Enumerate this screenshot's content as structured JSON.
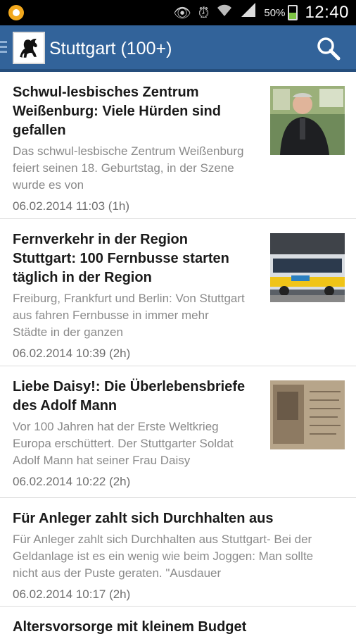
{
  "status_bar": {
    "app_icon": "notification-app-icon",
    "icons": [
      "eye-icon",
      "alarm-icon",
      "wifi-icon",
      "signal-icon"
    ],
    "battery_percent": "50%",
    "time": "12:40"
  },
  "action_bar": {
    "title": "Stuttgart (100+)",
    "logo_icon": "stuttgart-horse-logo",
    "search_icon": "search-icon"
  },
  "articles": [
    {
      "headline": "Schwul-lesbisches Zentrum Weißenburg: Viele Hürden sind gefallen",
      "teaser": "Das schwul-lesbische Zentrum Weißenburg feiert seinen 18. Geburtstag, in der Szene wurde es von",
      "meta": "06.02.2014 11:03 (1h)",
      "has_thumbnail": true
    },
    {
      "headline": "Fernverkehr in der Region Stuttgart: 100 Fernbusse starten täglich in der Region",
      "teaser": "Freiburg, Frankfurt und Berlin: Von Stuttgart aus fahren Fernbusse in immer mehr Städte in der ganzen",
      "meta": "06.02.2014 10:39 (2h)",
      "has_thumbnail": true
    },
    {
      "headline": "Liebe Daisy!: Die Überlebensbriefe des Adolf Mann",
      "teaser": "Vor 100 Jahren hat der Erste Weltkrieg Europa erschüttert. Der Stuttgarter Soldat Adolf Mann hat seiner Frau Daisy",
      "meta": "06.02.2014 10:22 (2h)",
      "has_thumbnail": true
    },
    {
      "headline": "Für Anleger zahlt sich Durchhalten aus",
      "teaser": "Für Anleger zahlt sich Durchhalten aus Stuttgart- Bei der Geldanlage ist es ein wenig wie beim Joggen: Man sollte nicht aus der Puste geraten. \"Ausdauer",
      "meta": "06.02.2014 10:17 (2h)",
      "has_thumbnail": false
    },
    {
      "headline": "Altersvorsorge mit kleinem Budget",
      "teaser": "",
      "meta": "",
      "has_thumbnail": false
    }
  ],
  "colors": {
    "action_bar": "#32639a",
    "status_bar": "#000000",
    "headline": "#1a1a1a",
    "teaser": "#8a8a8a"
  }
}
